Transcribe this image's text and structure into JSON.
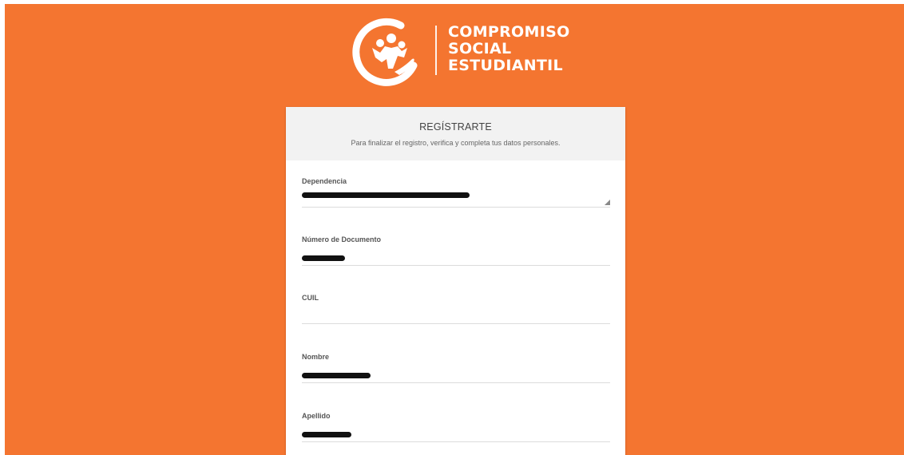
{
  "brand": {
    "line1": "COMPROMISO",
    "line2": "SOCIAL",
    "line3": "ESTUDIANTIL",
    "logo_icon": "people-circle-logo-icon",
    "background_color": "#f47530"
  },
  "form": {
    "title": "REGÍSTRARTE",
    "subtitle": "Para finalizar el registro, verifica y completa tus datos personales.",
    "fields": [
      {
        "label": "Dependencia",
        "value": "",
        "redacted": true,
        "type": "select"
      },
      {
        "label": "Número de Documento",
        "value": "",
        "redacted": true,
        "type": "text"
      },
      {
        "label": "CUIL",
        "value": "",
        "redacted": false,
        "type": "text"
      },
      {
        "label": "Nombre",
        "value": "",
        "redacted": true,
        "type": "text"
      },
      {
        "label": "Apellido",
        "value": "",
        "redacted": true,
        "type": "text"
      }
    ]
  }
}
